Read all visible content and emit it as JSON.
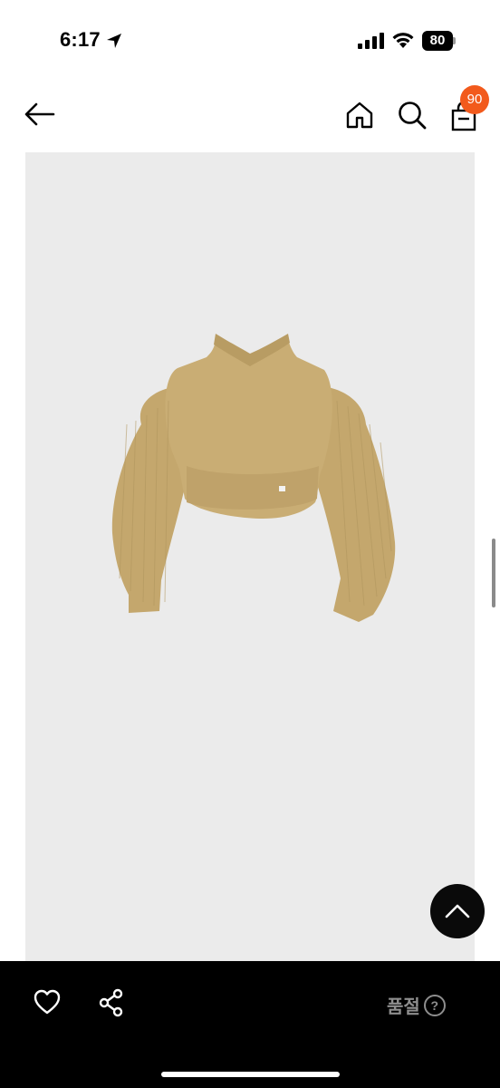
{
  "status_bar": {
    "time": "6:17",
    "battery_level": "80",
    "icons": [
      "location-arrow-icon",
      "cellular-signal-icon",
      "wifi-icon",
      "battery-icon"
    ]
  },
  "header": {
    "icons": [
      "back-arrow-icon",
      "home-icon",
      "search-icon",
      "shopping-bag-icon"
    ],
    "cart_count": "90",
    "badge_color": "#f25a1c"
  },
  "product": {
    "image_background": "#ebebeb",
    "sweater_color": "#c9ad74"
  },
  "bottom_bar": {
    "status_label": "품절",
    "help_symbol": "?",
    "icons": [
      "heart-icon",
      "share-icon",
      "help-circle-icon"
    ]
  },
  "floating": {
    "icon": "chevron-up-icon"
  }
}
